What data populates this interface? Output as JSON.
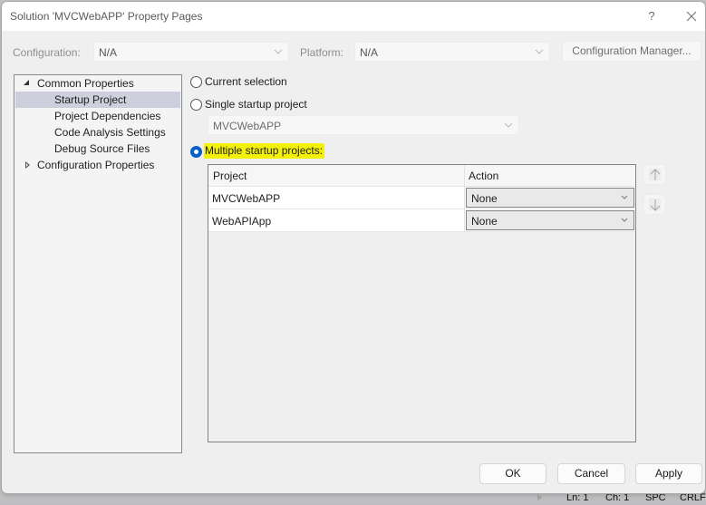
{
  "window": {
    "title": "Solution 'MVCWebAPP' Property Pages",
    "help_label": "?",
    "close_icon": "close-icon"
  },
  "toolbar": {
    "configuration_label": "Configuration:",
    "configuration_value": "N/A",
    "platform_label": "Platform:",
    "platform_value": "N/A",
    "config_manager_label": "Configuration Manager..."
  },
  "tree": {
    "items": [
      {
        "label": "Common Properties",
        "level": 0,
        "expander": "expanded"
      },
      {
        "label": "Startup Project",
        "level": 1,
        "selected": true
      },
      {
        "label": "Project Dependencies",
        "level": 1
      },
      {
        "label": "Code Analysis Settings",
        "level": 1
      },
      {
        "label": "Debug Source Files",
        "level": 1
      },
      {
        "label": "Configuration Properties",
        "level": 0,
        "expander": "collapsed"
      }
    ]
  },
  "startup": {
    "options": [
      {
        "label": "Current selection",
        "checked": false
      },
      {
        "label": "Single startup project",
        "checked": false
      },
      {
        "label": "Multiple startup projects:",
        "checked": true,
        "highlighted": true
      }
    ],
    "single_project_value": "MVCWebAPP",
    "highlight_color": "#f3f00a",
    "radio_accent": "#0a5ec7"
  },
  "grid": {
    "columns": [
      "Project",
      "Action"
    ],
    "rows": [
      {
        "project": "MVCWebAPP",
        "action": "None"
      },
      {
        "project": "WebAPIApp",
        "action": "None"
      }
    ],
    "move_up_icon": "arrow-up-icon",
    "move_down_icon": "arrow-down-icon"
  },
  "footer": {
    "ok_label": "OK",
    "cancel_label": "Cancel",
    "apply_label": "Apply"
  },
  "statusbar": {
    "line": "Ln: 1",
    "char": "Ch: 1",
    "spacing": "SPC",
    "line_ending": "CRLF"
  }
}
